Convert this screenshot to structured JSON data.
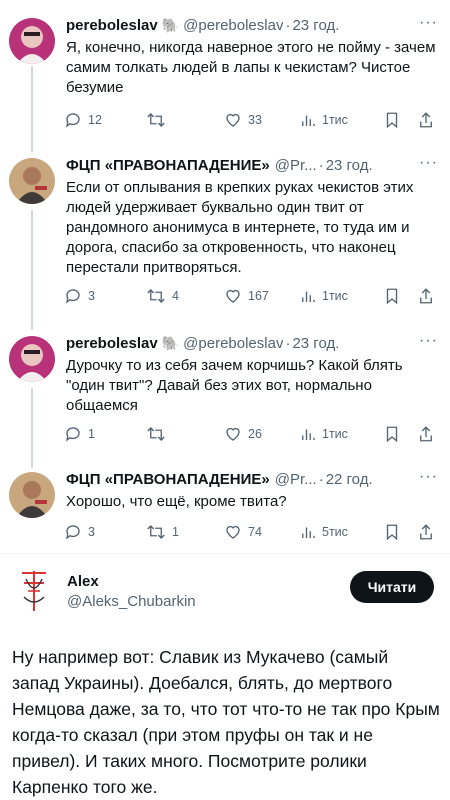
{
  "tweets": [
    {
      "name": "pereboleslav",
      "emoji": "🐘",
      "handle": "@pereboleslav",
      "time": "23 год.",
      "text": "Я, конечно, никогда наверное этого не пойму - зачем самим толкать людей в лапы к чекистам? Чистое безумие",
      "replies": "12",
      "retweets": "",
      "likes": "33",
      "views": "1тис"
    },
    {
      "name": "ФЦП «ПРАВОНАПАДЕНИЕ»",
      "emoji": "",
      "handle": "@Pr...",
      "time": "23 год.",
      "text": "Если от оплывания в крепких руках чекистов этих людей удерживает буквально один твит от рандомного анонимуса в интернете, то туда им и дорога, спасибо за откровенность, что наконец перестали притворяться.",
      "replies": "3",
      "retweets": "4",
      "likes": "167",
      "views": "1тис"
    },
    {
      "name": "pereboleslav",
      "emoji": "🐘",
      "handle": "@pereboleslav",
      "time": "23 год.",
      "text": "Дурочку то из себя зачем корчишь? Какой блять \"один твит\"? Давай без этих вот, нормально общаемся",
      "replies": "1",
      "retweets": "",
      "likes": "26",
      "views": "1тис"
    },
    {
      "name": "ФЦП «ПРАВОНАПАДЕНИЕ»",
      "emoji": "",
      "handle": "@Pr...",
      "time": "22 год.",
      "text": "Хорошо, что ещё, кроме твита?",
      "replies": "3",
      "retweets": "1",
      "likes": "74",
      "views": "5тис"
    }
  ],
  "separator": "·",
  "author": {
    "name": "Alex",
    "handle": "@Aleks_Chubarkin",
    "read_label": "Читати",
    "text": "Ну например вот: Славик из Мукачево (самый запад Украины). Доебался, блять, до мертвого Немцова даже, за то, что тот что-то не так про Крым когда-то сказал (при этом пруфы он так и не привел). И таких много. Посмотрите ролики Карпенко того же."
  },
  "colors": {
    "text": "#0f1419",
    "muted": "#536471",
    "button": "#0f1419",
    "avatar1": "#b8327a",
    "avatar2": "#c9a77e"
  }
}
